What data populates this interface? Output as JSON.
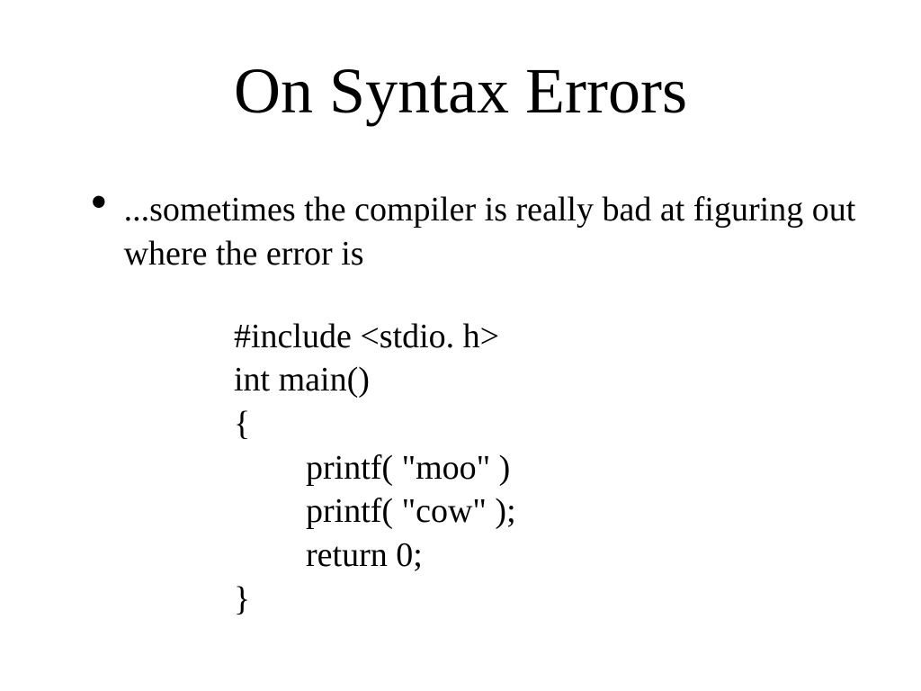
{
  "slide": {
    "title": "On Syntax Errors",
    "bullet": {
      "mark": "•",
      "text": "...sometimes the compiler is really bad at figuring out where the error is"
    },
    "code": {
      "line1": "#include <stdio. h>",
      "line2": "int main()",
      "line3": "{",
      "line4": "printf( \"moo\" )",
      "line5": "printf( \"cow\" );",
      "line6": "return 0;",
      "line7": "}"
    }
  }
}
